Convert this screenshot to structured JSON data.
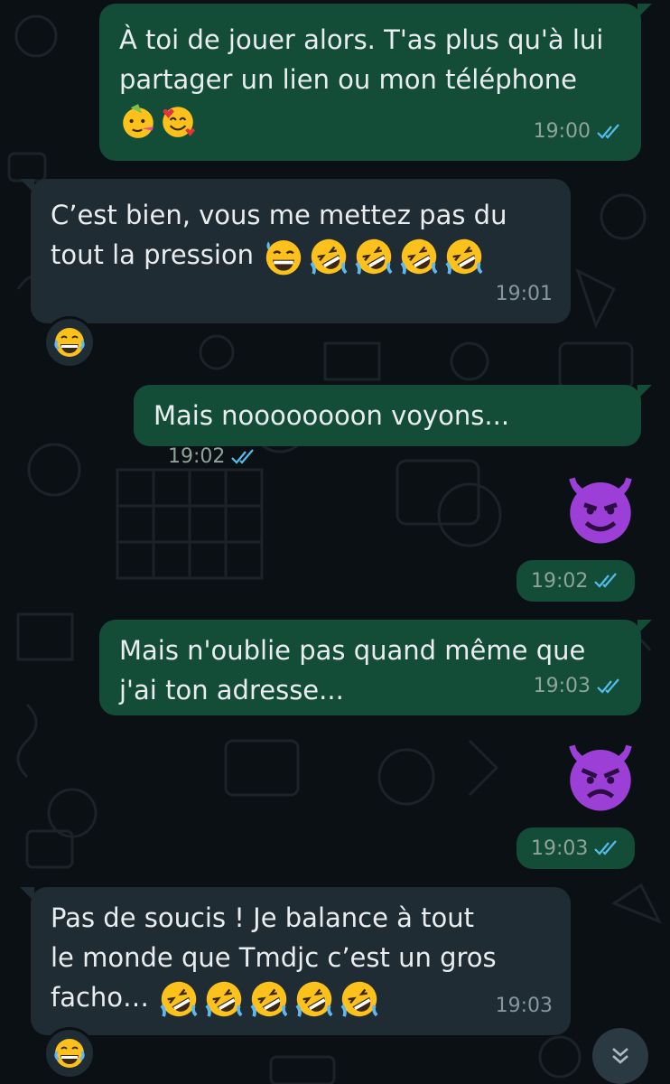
{
  "colors": {
    "background": "#0b1014",
    "outgoing_bubble": "#134d37",
    "incoming_bubble": "#1f2c33",
    "read_ticks": "#53bdeb"
  },
  "messages": [
    {
      "id": "m1",
      "direction": "outgoing",
      "lines": [
        "À toi de jouer alors. T'as plus qu'à lui",
        "partager un lien ou mon téléphone"
      ],
      "emojis": [
        "partying-face",
        "smiling-face-with-hearts"
      ],
      "time": "19:00",
      "status": "read"
    },
    {
      "id": "m2",
      "direction": "incoming",
      "lines": [
        "C’est bien, vous me mettez pas du",
        "tout la pression"
      ],
      "emojis": [
        "grinning-sweat-face",
        "rolling-laughing-face",
        "rolling-laughing-face",
        "rolling-laughing-face",
        "rolling-laughing-face"
      ],
      "time": "19:01",
      "reaction": "face-with-tears-of-joy"
    },
    {
      "id": "m3",
      "direction": "outgoing",
      "text": "Mais noooooooon voyons...",
      "time": "19:02",
      "status": "read"
    },
    {
      "id": "m4",
      "direction": "outgoing",
      "emoji_only": "smiling-face-with-horns",
      "time": "19:02",
      "status": "read"
    },
    {
      "id": "m5",
      "direction": "outgoing",
      "lines": [
        "Mais n'oublie pas quand même que",
        "j'ai ton adresse..."
      ],
      "time": "19:03",
      "status": "read"
    },
    {
      "id": "m6",
      "direction": "outgoing",
      "emoji_only": "angry-face-with-horns",
      "time": "19:03",
      "status": "read"
    },
    {
      "id": "m7",
      "direction": "incoming",
      "lines": [
        "Pas de soucis ! Je balance à tout",
        "le monde que Tmdjc c’est un gros",
        "facho…"
      ],
      "emojis": [
        "rolling-laughing-face",
        "rolling-laughing-face",
        "rolling-laughing-face",
        "rolling-laughing-face",
        "rolling-laughing-face"
      ],
      "time": "19:03",
      "reaction": "face-with-tears-of-joy"
    }
  ],
  "scroll_button_icon": "double-chevron-down-icon"
}
